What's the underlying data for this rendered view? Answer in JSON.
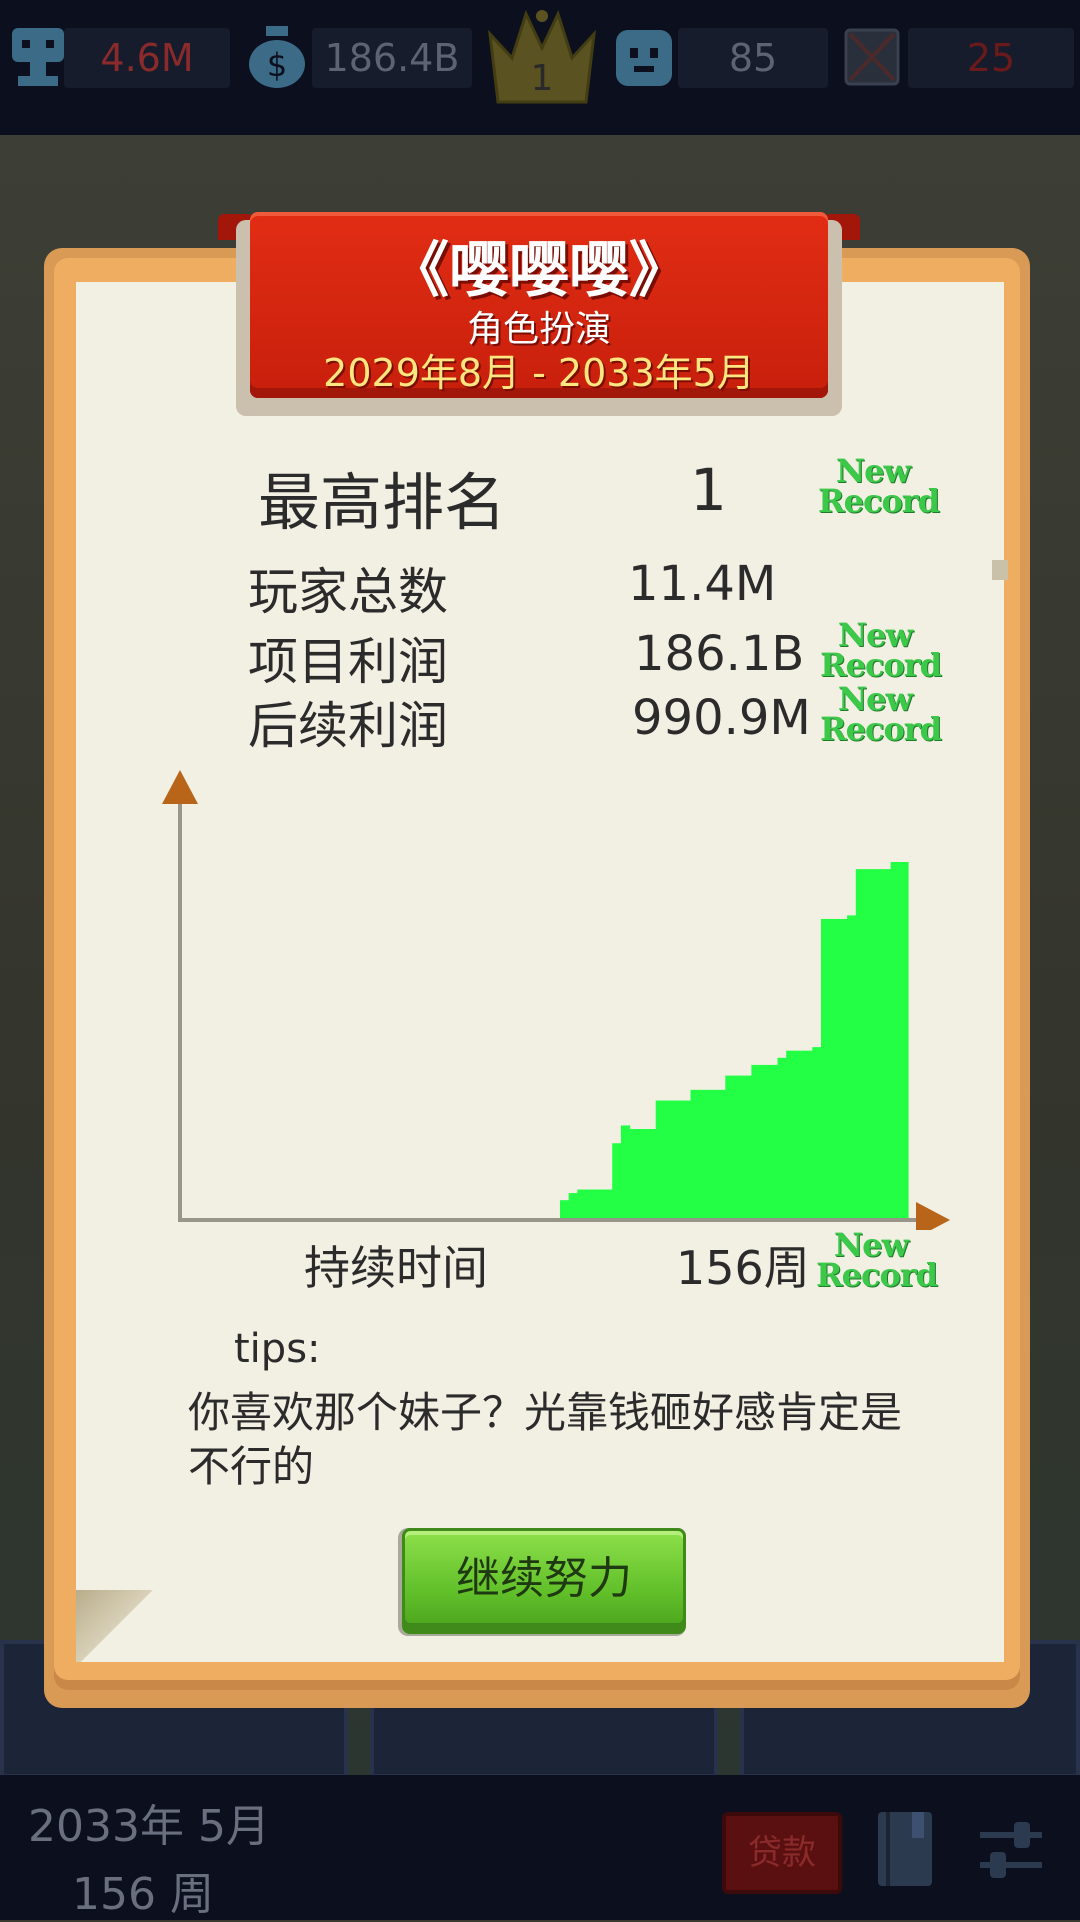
{
  "hud": {
    "fans": "4.6M",
    "money": "186.4B",
    "rank": "1",
    "staff": "85",
    "bugs": "25"
  },
  "banner": {
    "title": "《嘤嘤嘤》",
    "genre": "角色扮演",
    "period": "2029年8月 - 2033年5月"
  },
  "stats": {
    "best_rank_label": "最高排名",
    "best_rank_value": "1",
    "players_label": "玩家总数",
    "players_value": "11.4M",
    "profit_label": "项目利润",
    "profit_value": "186.1B",
    "after_profit_label": "后续利润",
    "after_profit_value": "990.9M",
    "new_record_line1": "New",
    "new_record_line2": "Record"
  },
  "chart_data": {
    "type": "area",
    "x": [
      1,
      2,
      3,
      4,
      5,
      6,
      7,
      8,
      9,
      10,
      11,
      12,
      13,
      14,
      15,
      16,
      17,
      18,
      19,
      20,
      21,
      22,
      23,
      24,
      25,
      26,
      27,
      28,
      29,
      30,
      31,
      32,
      33,
      34,
      35,
      36,
      37,
      38,
      39,
      40
    ],
    "values": [
      0,
      0,
      0,
      0,
      0,
      0,
      0,
      0,
      0,
      0,
      0,
      0,
      0,
      0,
      0,
      0,
      0,
      0,
      0,
      0,
      0,
      0,
      0,
      0,
      0,
      0,
      0,
      0,
      0,
      0,
      0,
      0,
      0,
      0,
      0,
      0,
      0,
      0,
      0,
      0
    ],
    "series": [
      {
        "values": [
          5,
          7,
          8,
          8,
          8,
          8,
          21,
          26,
          25,
          25,
          25,
          33,
          33,
          33,
          33,
          36,
          36,
          36,
          36,
          40,
          40,
          40,
          43,
          43,
          43,
          45,
          47,
          47,
          47,
          48,
          84,
          84,
          84,
          85,
          98,
          98,
          98,
          98,
          100,
          100
        ]
      }
    ],
    "xlabel": "持续时间",
    "ylabel": "",
    "ylim": [
      0,
      100
    ],
    "grid": false,
    "color": "#22ff44"
  },
  "duration": {
    "label": "持续时间",
    "value": "156周"
  },
  "tips": {
    "label": "tips:",
    "text": "你喜欢那个妹子？光靠钱砸好感肯定是不行的"
  },
  "button": {
    "continue_label": "继续努力"
  },
  "bottom": {
    "date": "2033年 5月",
    "week": "156 周",
    "loan_label": "贷款"
  }
}
